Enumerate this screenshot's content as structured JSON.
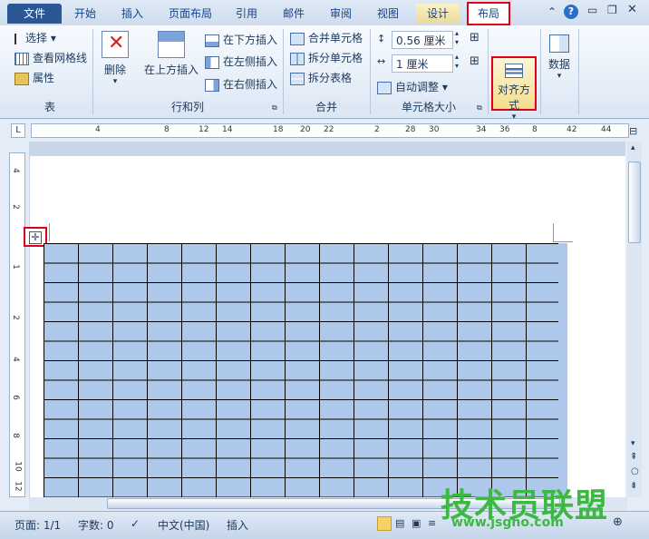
{
  "tabs": [
    "文件",
    "开始",
    "插入",
    "页面布局",
    "引用",
    "邮件",
    "审阅",
    "视图",
    "设计",
    "布局"
  ],
  "ribbon": {
    "table_group": {
      "select": "选择",
      "gridlines": "查看网格线",
      "properties": "属性",
      "label": "表"
    },
    "rowscols_group": {
      "delete": "删除",
      "insert_above": "在上方插入",
      "insert_below": "在下方插入",
      "insert_left": "在左侧插入",
      "insert_right": "在右侧插入",
      "label": "行和列"
    },
    "merge_group": {
      "merge": "合并单元格",
      "split_cells": "拆分单元格",
      "split_table": "拆分表格",
      "label": "合并"
    },
    "cellsize_group": {
      "height": "0.56 厘米",
      "width": "1 厘米",
      "autofit": "自动调整",
      "label": "单元格大小"
    },
    "align_group": {
      "label": "对齐方式"
    },
    "data_group": {
      "label": "数据"
    }
  },
  "ruler": {
    "h_numbers": [
      "4",
      "8",
      "12",
      "14",
      "18",
      "20",
      "22",
      "2",
      "28",
      "30",
      "34",
      "36",
      "8",
      "42",
      "44"
    ],
    "v_numbers": [
      "4",
      "2",
      "1",
      "2",
      "4",
      "6",
      "8",
      "10",
      "12"
    ]
  },
  "status": {
    "page": "页面: 1/1",
    "words": "字数: 0",
    "lang": "中文(中国)",
    "mode": "插入"
  },
  "watermark": {
    "title": "技术员联盟",
    "url": "www.jsgho.com"
  },
  "colors": {
    "accent": "#e0001b",
    "table_fill": "#adc8ea",
    "file_tab": "#2b5797"
  }
}
